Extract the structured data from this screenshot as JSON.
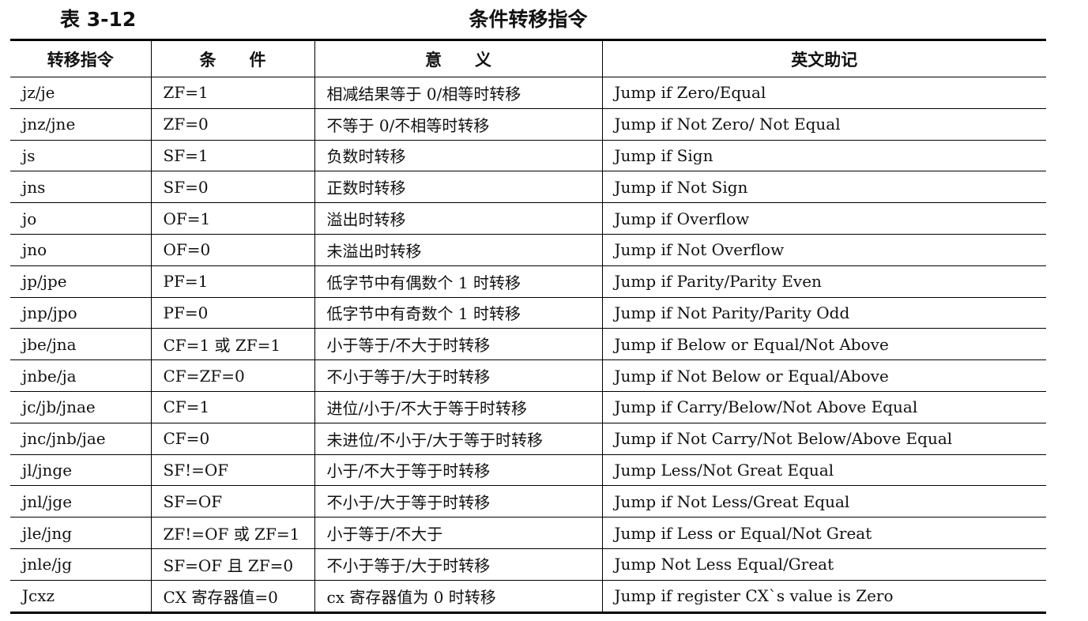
{
  "caption": {
    "number": "表 3-12",
    "title": "条件转移指令"
  },
  "headers": [
    "转移指令",
    "条　　件",
    "意　　义",
    "英文助记"
  ],
  "rows": [
    [
      "jz/je",
      "ZF=1",
      "相减结果等于 0/相等时转移",
      "Jump if Zero/Equal"
    ],
    [
      "jnz/jne",
      "ZF=0",
      "不等于 0/不相等时转移",
      "Jump if Not Zero/ Not Equal"
    ],
    [
      "js",
      "SF=1",
      "负数时转移",
      "Jump if Sign"
    ],
    [
      "jns",
      "SF=0",
      "正数时转移",
      "Jump if Not Sign"
    ],
    [
      "jo",
      "OF=1",
      "溢出时转移",
      "Jump if Overflow"
    ],
    [
      "jno",
      "OF=0",
      "未溢出时转移",
      "Jump if Not Overflow"
    ],
    [
      "jp/jpe",
      "PF=1",
      "低字节中有偶数个 1 时转移",
      "Jump if Parity/Parity Even"
    ],
    [
      "jnp/jpo",
      "PF=0",
      "低字节中有奇数个 1 时转移",
      "Jump if Not Parity/Parity Odd"
    ],
    [
      "jbe/jna",
      "CF=1 或 ZF=1",
      "小于等于/不大于时转移",
      "Jump if Below or Equal/Not Above"
    ],
    [
      "jnbe/ja",
      "CF=ZF=0",
      "不小于等于/大于时转移",
      "Jump if Not Below or Equal/Above"
    ],
    [
      "jc/jb/jnae",
      "CF=1",
      "进位/小于/不大于等于时转移",
      "Jump if Carry/Below/Not Above Equal"
    ],
    [
      "jnc/jnb/jae",
      "CF=0",
      "未进位/不小于/大于等于时转移",
      "Jump if Not Carry/Not Below/Above Equal"
    ],
    [
      "jl/jnge",
      "SF!=OF",
      "小于/不大于等于时转移",
      "Jump Less/Not Great Equal"
    ],
    [
      "jnl/jge",
      "SF=OF",
      "不小于/大于等于时转移",
      "Jump if Not Less/Great Equal"
    ],
    [
      "jle/jng",
      "ZF!=OF 或 ZF=1",
      "小于等于/不大于",
      "Jump if Less or Equal/Not Great"
    ],
    [
      "jnle/jg",
      "SF=OF 且 ZF=0",
      "不小于等于/大于时转移",
      "Jump Not Less Equal/Great"
    ],
    [
      "Jcxz",
      "CX 寄存器值=0",
      "cx 寄存器值为 0 时转移",
      "Jump if register CX`s value is Zero"
    ]
  ]
}
